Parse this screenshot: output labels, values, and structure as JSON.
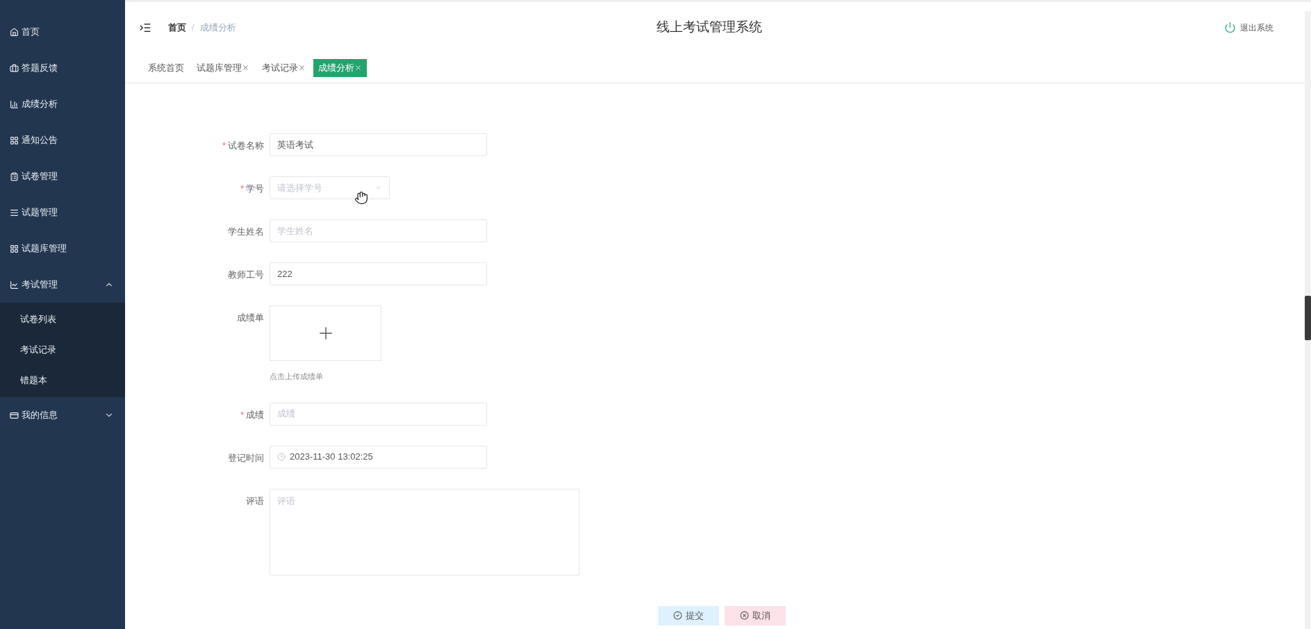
{
  "sidebar": {
    "items": [
      {
        "label": "首页",
        "kind": "link"
      },
      {
        "label": "答题反馈",
        "kind": "link"
      },
      {
        "label": "成绩分析",
        "kind": "link"
      },
      {
        "label": "通知公告",
        "kind": "link"
      },
      {
        "label": "试卷管理",
        "kind": "link"
      },
      {
        "label": "试题管理",
        "kind": "link"
      },
      {
        "label": "试题库管理",
        "kind": "link"
      },
      {
        "label": "考试管理",
        "kind": "group",
        "expanded": true,
        "children": [
          {
            "label": "试卷列表"
          },
          {
            "label": "考试记录"
          },
          {
            "label": "错题本"
          }
        ]
      },
      {
        "label": "我的信息",
        "kind": "group",
        "expanded": false
      }
    ]
  },
  "header": {
    "breadcrumb_separator": "/",
    "breadcrumb": [
      {
        "label": "首页",
        "current": false
      },
      {
        "label": "成绩分析",
        "current": true
      }
    ],
    "title": "线上考试管理系统",
    "logout": "退出系统"
  },
  "tabs": [
    {
      "label": "系统首页",
      "selected": false,
      "closable": false
    },
    {
      "label": "试题库管理",
      "selected": false,
      "closable": true
    },
    {
      "label": "考试记录",
      "selected": false,
      "closable": true
    },
    {
      "label": "成绩分析",
      "selected": true,
      "closable": true
    }
  ],
  "form": {
    "required_mark": "*",
    "fields": [
      {
        "kind": "text",
        "label": "试卷名称",
        "required": true,
        "value": "英语考试"
      },
      {
        "kind": "select",
        "label": "学号",
        "required": true,
        "placeholder": "请选择学号"
      },
      {
        "kind": "text",
        "label": "学生姓名",
        "required": false,
        "placeholder": "学生姓名"
      },
      {
        "kind": "text",
        "label": "教师工号",
        "required": false,
        "value": "222"
      },
      {
        "kind": "upload",
        "label": "成绩单",
        "required": false,
        "hint": "点击上传成绩单"
      },
      {
        "kind": "text",
        "label": "成绩",
        "required": true,
        "placeholder": "成绩"
      },
      {
        "kind": "datetime",
        "label": "登记时间",
        "required": false,
        "value": "2023-11-30 13:02:25"
      },
      {
        "kind": "textarea",
        "label": "评语",
        "required": false,
        "placeholder": "评语"
      }
    ],
    "buttons": [
      {
        "kind": "submit",
        "label": "提交"
      },
      {
        "kind": "cancel",
        "label": "取消"
      }
    ]
  }
}
